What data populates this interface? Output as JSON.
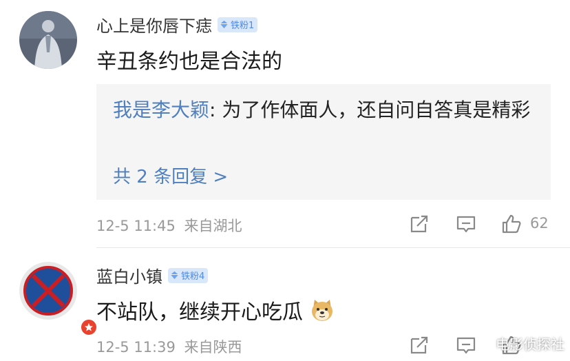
{
  "comments": [
    {
      "username": "心上是你唇下痣",
      "badge": "铁粉1",
      "content": "辛丑条约也是合法的",
      "reply": {
        "user": "我是李大颖",
        "separator": ": ",
        "text": "为了作体面人，还自问自答真是精彩",
        "count_label": "共 2 条回复 >"
      },
      "time": "12-5 11:45",
      "location": "来自湖北",
      "likes": "62"
    },
    {
      "username": "蓝白小镇",
      "badge": "铁粉4",
      "content": "不站队，继续开心吃瓜",
      "time": "12-5 11:39",
      "location": "来自陕西"
    }
  ],
  "watermark": "电影侦探社",
  "colors": {
    "link_blue": "#4f7fbf",
    "badge_bg": "#d9e7fb",
    "meta_gray": "#999999",
    "reply_bg": "#f5f5f5"
  },
  "icons": [
    "share-icon",
    "reply-icon",
    "like-icon",
    "diamond-icon",
    "star-icon",
    "doge-emoji"
  ]
}
